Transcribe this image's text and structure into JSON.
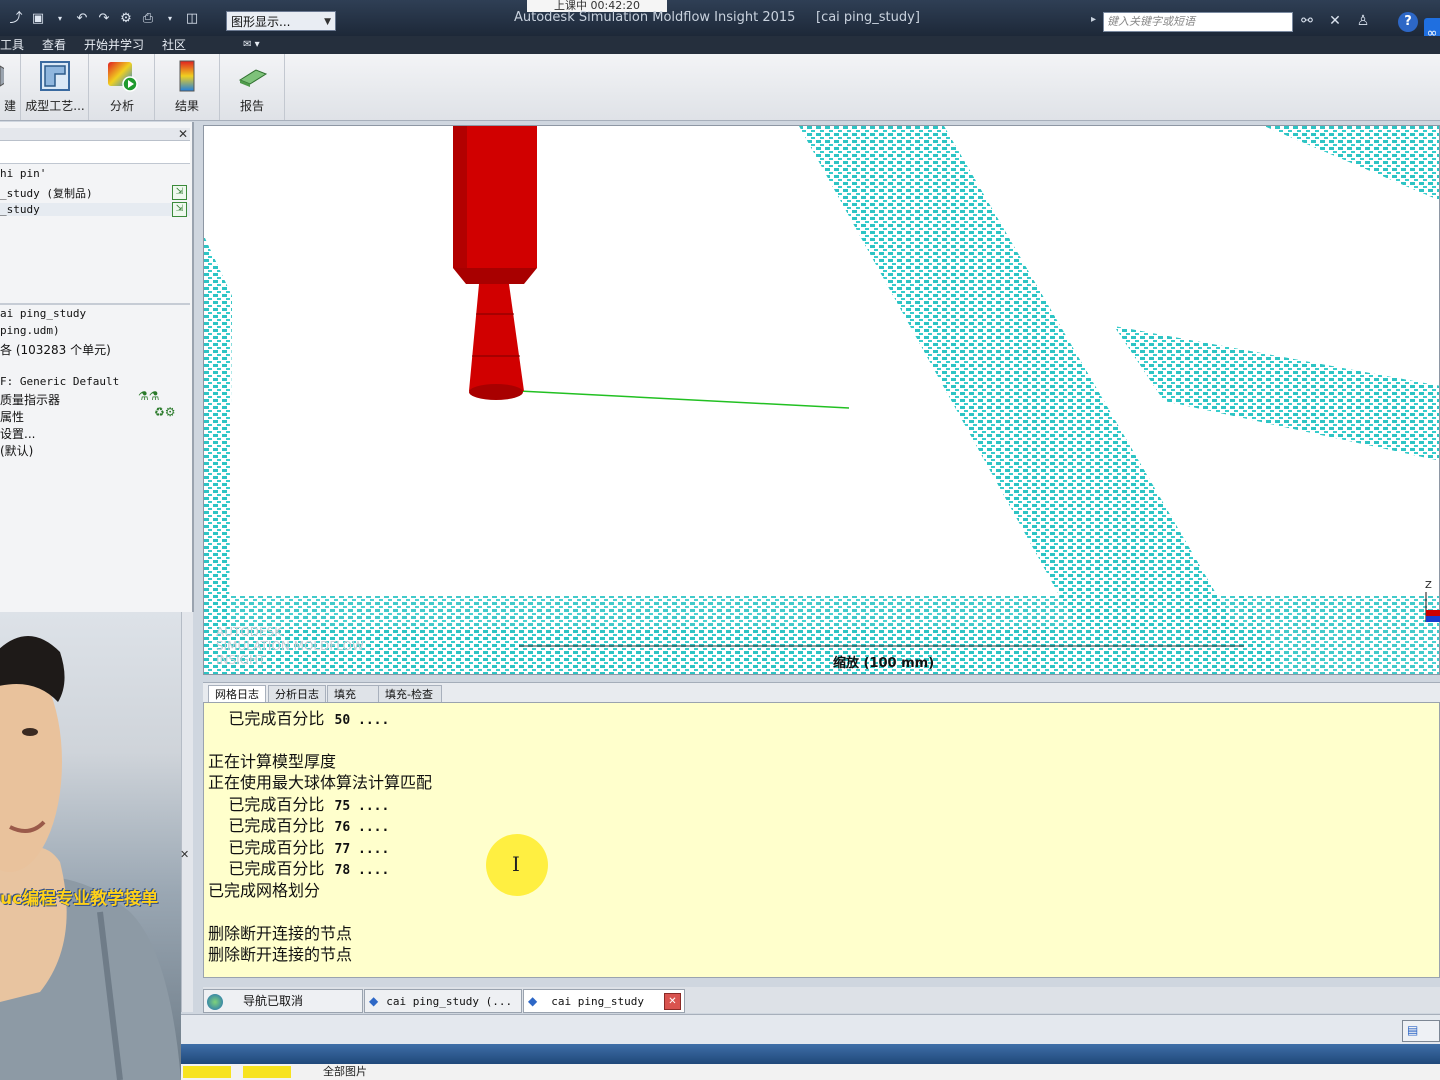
{
  "titlebar": {
    "graphics_dropdown": "图形显示...",
    "recording_timer": "上课中 00:42:20",
    "app_title": "Autodesk Simulation Moldflow Insight 2015",
    "study_title": "[cai ping_study]",
    "search_placeholder": "键入关键字或短语",
    "help_label": "?"
  },
  "menu": {
    "items": [
      "工具",
      "查看",
      "开始并学习",
      "社区"
    ]
  },
  "ribbon": {
    "buttons": [
      {
        "label": "建",
        "icon": "partial-icon"
      },
      {
        "label": "成型工艺...",
        "icon": "molding-process-icon"
      },
      {
        "label": "分析",
        "icon": "analysis-icon"
      },
      {
        "label": "结果",
        "icon": "results-icon"
      },
      {
        "label": "报告",
        "icon": "report-icon"
      }
    ]
  },
  "project_tree": {
    "items": [
      "hi pin'",
      "_study (复制品)",
      "_study"
    ]
  },
  "study_tasks": {
    "items": [
      "ai ping_study",
      "ping.udm)",
      "各 (103283 个单元)",
      "F: Generic Default",
      "质量指示器",
      "属性",
      "设置...",
      "(默认)"
    ]
  },
  "webcam": {
    "caption": "uc编程专业教学接单"
  },
  "viewport": {
    "scale_label": "缩放 (100 mm)",
    "watermark": "AUTODESK\nSIMULATION MOLDFLOW\nINSIGHT",
    "axis_label": "Z"
  },
  "log_tabs": [
    "网格日志",
    "分析日志",
    "填充",
    "填充-检查"
  ],
  "log_lines": [
    {
      "text": "    已完成百分比  ",
      "num": "50",
      "dots": " ...."
    },
    {
      "text": "",
      "num": "",
      "dots": ""
    },
    {
      "text": "正在计算模型厚度",
      "num": "",
      "dots": ""
    },
    {
      "text": "正在使用最大球体算法计算匹配",
      "num": "",
      "dots": ""
    },
    {
      "text": "    已完成百分比  ",
      "num": "75",
      "dots": " ...."
    },
    {
      "text": "    已完成百分比  ",
      "num": "76",
      "dots": " ...."
    },
    {
      "text": "    已完成百分比  ",
      "num": "77",
      "dots": " ...."
    },
    {
      "text": "    已完成百分比  ",
      "num": "78",
      "dots": " ...."
    },
    {
      "text": "已完成网格划分",
      "num": "",
      "dots": ""
    },
    {
      "text": "",
      "num": "",
      "dots": ""
    },
    {
      "text": "删除断开连接的节点",
      "num": "",
      "dots": ""
    },
    {
      "text": "删除断开连接的节点",
      "num": "",
      "dots": ""
    }
  ],
  "doc_tabs": [
    {
      "label": "导航已取消"
    },
    {
      "label": "cai ping_study (..."
    },
    {
      "label": "cai ping_study"
    }
  ],
  "taskbar": {
    "item_label": "全部图片"
  },
  "colors": {
    "mesh": "#2ec4c4",
    "nozzle": "#d10000",
    "log_bg": "#ffffcc",
    "caption": "#ffd11a"
  }
}
